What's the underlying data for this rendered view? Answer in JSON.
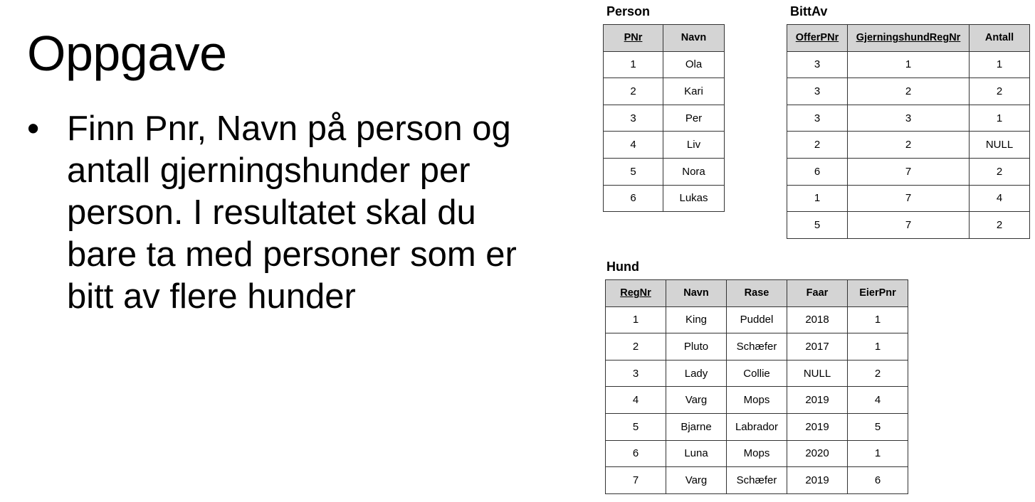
{
  "slide": {
    "title": "Oppgave",
    "bullets": [
      {
        "marker": "•",
        "text": "Finn Pnr, Navn på person og antall gjerningshunder per person. I resultatet skal du bare ta med personer som er bitt av flere hunder"
      }
    ]
  },
  "tables": {
    "person": {
      "caption": "Person",
      "columns": [
        "PNr",
        "Navn"
      ],
      "rows": [
        [
          "1",
          "Ola"
        ],
        [
          "2",
          "Kari"
        ],
        [
          "3",
          "Per"
        ],
        [
          "4",
          "Liv"
        ],
        [
          "5",
          "Nora"
        ],
        [
          "6",
          "Lukas"
        ]
      ]
    },
    "bittav": {
      "caption": "BittAv",
      "columns": [
        "OfferPNr",
        "GjerningshundRegNr",
        "Antall"
      ],
      "rows": [
        [
          "3",
          "1",
          "1"
        ],
        [
          "3",
          "2",
          "2"
        ],
        [
          "3",
          "3",
          "1"
        ],
        [
          "2",
          "2",
          "NULL"
        ],
        [
          "6",
          "7",
          "2"
        ],
        [
          "1",
          "7",
          "4"
        ],
        [
          "5",
          "7",
          "2"
        ]
      ]
    },
    "hund": {
      "caption": "Hund",
      "columns": [
        "RegNr",
        "Navn",
        "Rase",
        "Faar",
        "EierPnr"
      ],
      "rows": [
        [
          "1",
          "King",
          "Puddel",
          "2018",
          "1"
        ],
        [
          "2",
          "Pluto",
          "Schæfer",
          "2017",
          "1"
        ],
        [
          "3",
          "Lady",
          "Collie",
          "NULL",
          "2"
        ],
        [
          "4",
          "Varg",
          "Mops",
          "2019",
          "4"
        ],
        [
          "5",
          "Bjarne",
          "Labrador",
          "2019",
          "5"
        ],
        [
          "6",
          "Luna",
          "Mops",
          "2020",
          "1"
        ],
        [
          "7",
          "Varg",
          "Schæfer",
          "2019",
          "6"
        ]
      ]
    }
  }
}
